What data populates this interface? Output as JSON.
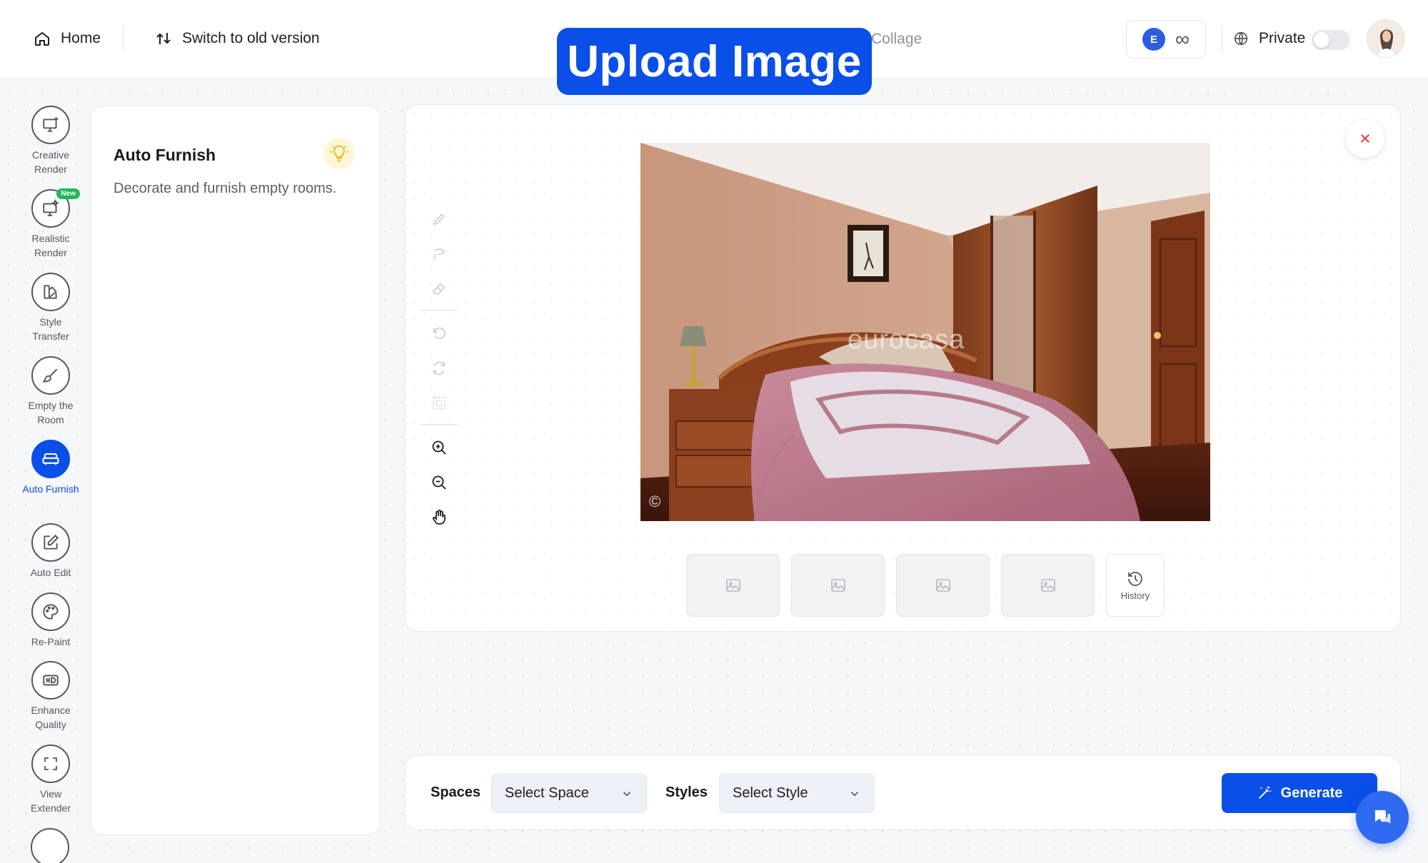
{
  "header": {
    "home_label": "Home",
    "switch_label": "Switch to old version",
    "center_tab_partial": "Collage",
    "upload_banner": "Upload Image",
    "credits_symbol": "∞",
    "private_label": "Private"
  },
  "sidebar": {
    "items": [
      {
        "label": "Creative Render",
        "icon": "monitor-plus-icon"
      },
      {
        "label": "Realistic Render",
        "icon": "monitor-sparkle-icon",
        "badge": "New"
      },
      {
        "label": "Style Transfer",
        "icon": "palette-swatch-icon"
      },
      {
        "label": "Empty the Room",
        "icon": "brush-icon"
      },
      {
        "label": "Auto Furnish",
        "icon": "sofa-icon",
        "active": true
      },
      {
        "label": "Auto Edit",
        "icon": "edit-square-icon"
      },
      {
        "label": "Re-Paint",
        "icon": "paint-palette-icon"
      },
      {
        "label": "Enhance Quality",
        "icon": "hd-icon"
      },
      {
        "label": "View Extender",
        "icon": "expand-icon"
      }
    ]
  },
  "info_panel": {
    "title": "Auto Furnish",
    "description": "Decorate and furnish empty rooms."
  },
  "canvas": {
    "watermark": "eurocasa",
    "copyright_mark": "©",
    "history_label": "History",
    "thumbnail_count": 4
  },
  "bottom_bar": {
    "spaces_label": "Spaces",
    "spaces_value": "Select Space",
    "styles_label": "Styles",
    "styles_value": "Select Style",
    "generate_label": "Generate"
  },
  "colors": {
    "accent": "#0a4fe8",
    "new_badge": "#1fb957",
    "close_x": "#e03b3b"
  }
}
